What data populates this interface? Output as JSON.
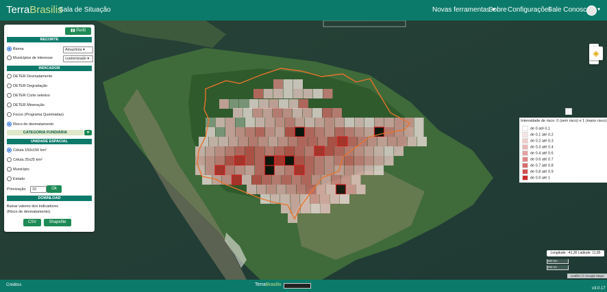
{
  "navbar": {
    "brand_left": "Terra",
    "brand_right": "Brasilis",
    "title": "Sala de Situação",
    "links": [
      "Novas ferramentas",
      "Sobre",
      "Configurações",
      "Fale Conosco"
    ],
    "tools_caret": "▾",
    "user_caret": "▾"
  },
  "panel": {
    "profile_button": "Perfil",
    "recorte": {
      "title": "RECORTE",
      "bioma_label": "Bioma",
      "bioma_value": "Amazônia",
      "municipios_label": "Municípios de interesse",
      "municipios_value": "customizado"
    },
    "indicador": {
      "title": "INDICADOR",
      "options": [
        "DETER Desmatamento",
        "DETER Degradação",
        "DETER Corte seletivo",
        "DETER Mineração",
        "Focos (Programa Queimadas)",
        "Risco de desmatamento"
      ],
      "selected_index": 5
    },
    "categoria": {
      "title": "CATEGORIA FUNDIÁRIA",
      "toggle": "▾"
    },
    "unidade": {
      "title": "UNIDADE ESPACIAL",
      "options": [
        "Célula 150x150 km²",
        "Célula 25x25 km²",
        "Município",
        "Estado"
      ],
      "selected_index": 0
    },
    "priorizacao": {
      "label": "Priorização",
      "value": "10",
      "ok": "Ok"
    },
    "download": {
      "title": "DOWNLOAD",
      "text_line1": "Baixar valores dos indicadores",
      "text_line2": "(Risco de desmatamento).",
      "csv": "CSV",
      "shapefile": "Shapefile"
    }
  },
  "map_controls": {
    "zoom_in": "+",
    "zoom_out": "−",
    "layers_icon": "stacked-layers-icon"
  },
  "legend": {
    "title": "Intensidade de risco: 0 (sem risco) e 1 (maior risco)",
    "items": [
      {
        "label": "de 0    até 0.1",
        "color": "#ffffff"
      },
      {
        "label": "de 0.1  até 0.2",
        "color": "#f7e4e4"
      },
      {
        "label": "de 0.2  até 0.3",
        "color": "#f2cccc"
      },
      {
        "label": "de 0.3  até 0.4",
        "color": "#ecb6b6"
      },
      {
        "label": "de 0.4  até 0.6",
        "color": "#e69f9f"
      },
      {
        "label": "de 0.6  até 0.7",
        "color": "#e08585"
      },
      {
        "label": "de 0.7  até 0.8",
        "color": "#da6b6b"
      },
      {
        "label": "de 0.8  até 0.9",
        "color": "#d44f4f"
      },
      {
        "label": "de 0.9  até 1",
        "color": "#cc2a2a"
      }
    ]
  },
  "map_info": {
    "coordinates": "Longitude: -41,35 Latitude: 11,85",
    "scale_km": "300 km",
    "scale_mi": "300 mi",
    "attribution": "Leaflet | © Google Maps"
  },
  "footer": {
    "credits": "Créditos",
    "logo_left": "Terra",
    "logo_right": "Brasilis",
    "version": "v3.0.17"
  },
  "colors": {
    "brand_green": "#0b7a6a",
    "button_green": "#1e8a55",
    "boundary_orange": "#e8742a"
  }
}
